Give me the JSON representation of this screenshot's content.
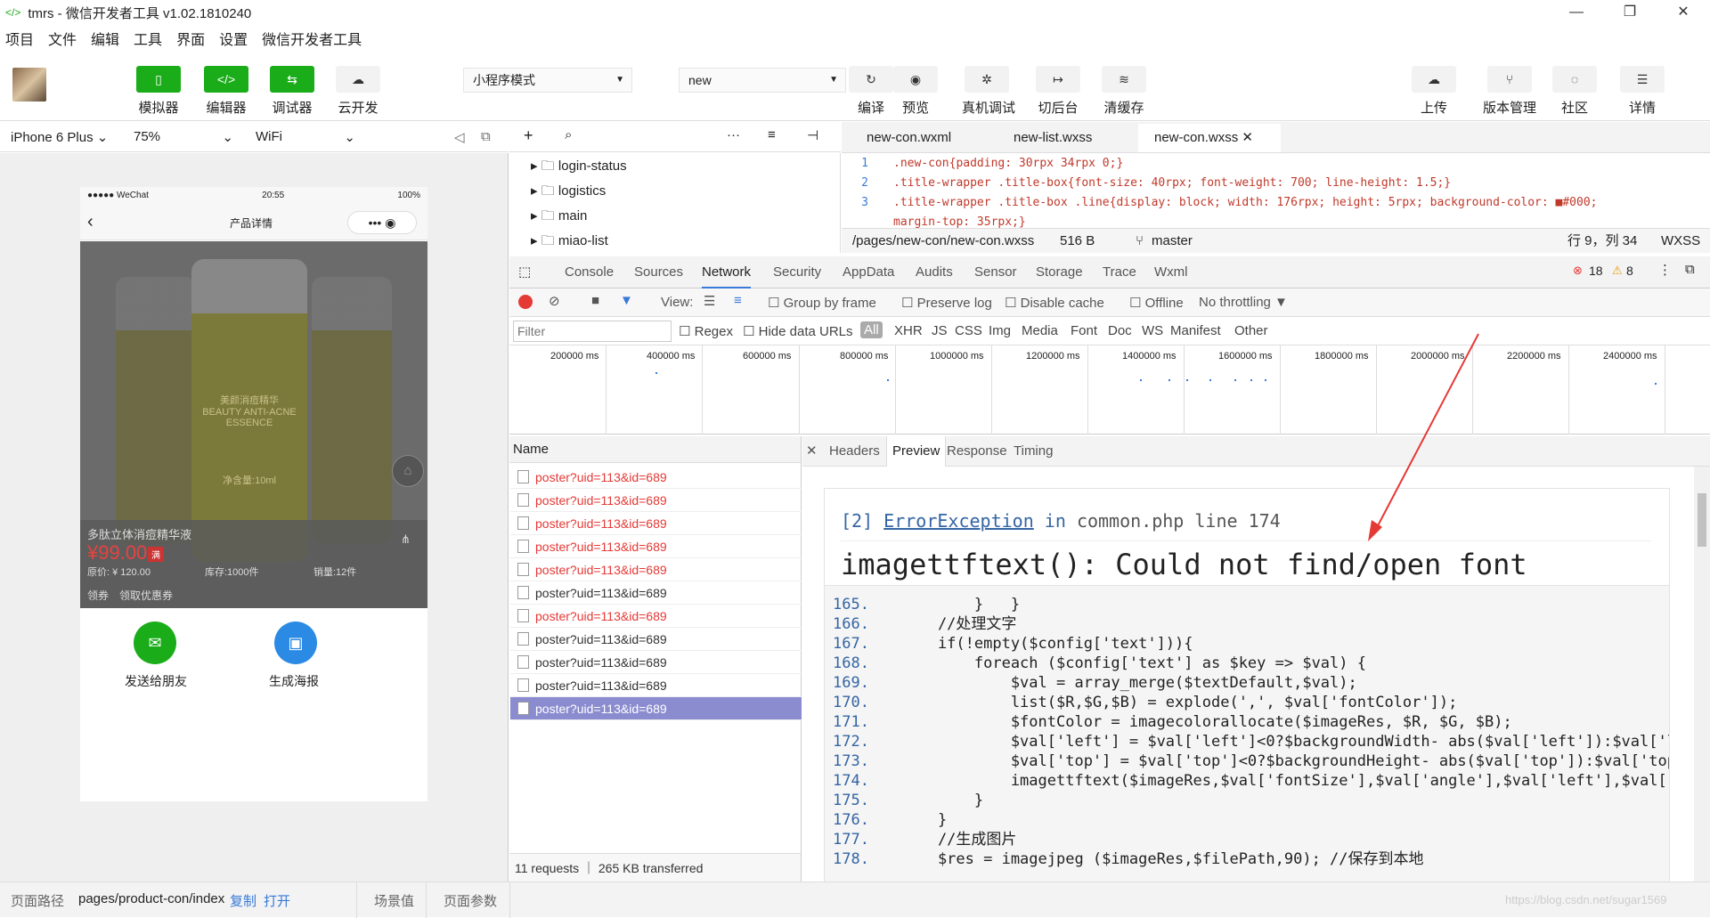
{
  "window": {
    "title": "tmrs - 微信开发者工具 v1.02.1810240",
    "min": "—",
    "max": "❐",
    "close": "✕"
  },
  "menu": [
    "项目",
    "文件",
    "编辑",
    "工具",
    "界面",
    "设置",
    "微信开发者工具"
  ],
  "toolbar": {
    "simulator": "模拟器",
    "editor": "编辑器",
    "debugger": "调试器",
    "cloud": "云开发",
    "mode": "小程序模式",
    "compile_select": "new",
    "compile": "编译",
    "preview": "预览",
    "remote_debug": "真机调试",
    "background": "切后台",
    "clear_cache": "清缓存",
    "upload": "上传",
    "version": "版本管理",
    "community": "社区",
    "details": "详情"
  },
  "simbar": {
    "device": "iPhone 6 Plus",
    "zoom": "75%",
    "network": "WiFi"
  },
  "phone": {
    "carrier": "●●●●● WeChat",
    "time": "20:55",
    "battery": "100%",
    "nav_title": "产品详情",
    "product_name": "多肽立体消痘精华液",
    "price": "¥99.00",
    "price_tag": "满",
    "orig_price": "原价: ¥ 120.00",
    "stock": "库存:1000件",
    "sales": "销量:12件",
    "coupon_label": "领券",
    "coupon_action": "领取优惠券",
    "bottle_text1": "美颜消痘精华",
    "bottle_text2": "BEAUTY ANTI-ACNE",
    "bottle_text3": "ESSENCE",
    "bottle_text4": "净含量:10ml",
    "share_friend": "发送给朋友",
    "gen_poster": "生成海报"
  },
  "filetree": [
    "login-status",
    "logistics",
    "main",
    "miao-list"
  ],
  "editor_tabs": [
    "new-con.wxml",
    "new-list.wxss",
    "new-con.wxss"
  ],
  "code_lines": [
    {
      "n": "1",
      "text": ".new-con{padding: 30rpx 34rpx 0;}"
    },
    {
      "n": "2",
      "text": ".title-wrapper .title-box{font-size: 40rpx; font-weight: 700; line-height: 1.5;}"
    },
    {
      "n": "3",
      "text": ".title-wrapper .title-box .line{display: block; width: 176rpx; height: 5rpx; background-color: ■#000;"
    },
    {
      "n": "",
      "text": "margin-top: 35rpx;}"
    }
  ],
  "editor_status": {
    "path": "/pages/new-con/new-con.wxss",
    "size": "516 B",
    "branch": "master",
    "pos": "行 9，列 34",
    "lang": "WXSS"
  },
  "devtools": {
    "tabs": [
      "Console",
      "Sources",
      "Network",
      "Security",
      "AppData",
      "Audits",
      "Sensor",
      "Storage",
      "Trace",
      "Wxml"
    ],
    "errors": "18",
    "warnings": "8",
    "view": "View:",
    "group_by_frame": "Group by frame",
    "preserve_log": "Preserve log",
    "disable_cache": "Disable cache",
    "offline": "Offline",
    "throttling": "No throttling",
    "filter_placeholder": "Filter",
    "regex": "Regex",
    "hide_data": "Hide data URLs",
    "types": [
      "All",
      "XHR",
      "JS",
      "CSS",
      "Img",
      "Media",
      "Font",
      "Doc",
      "WS",
      "Manifest",
      "Other"
    ],
    "timeline": [
      "200000 ms",
      "400000 ms",
      "600000 ms",
      "800000 ms",
      "1000000 ms",
      "1200000 ms",
      "1400000 ms",
      "1600000 ms",
      "1800000 ms",
      "2000000 ms",
      "2200000 ms",
      "2400000 ms"
    ],
    "name_header": "Name",
    "requests": [
      "poster?uid=113&id=689",
      "poster?uid=113&id=689",
      "poster?uid=113&id=689",
      "poster?uid=113&id=689",
      "poster?uid=113&id=689",
      "poster?uid=113&id=689",
      "poster?uid=113&id=689",
      "poster?uid=113&id=689",
      "poster?uid=113&id=689",
      "poster?uid=113&id=689",
      "poster?uid=113&id=689"
    ],
    "summary": "11 requests ｜ 265 KB transferred",
    "detail_tabs": [
      "Headers",
      "Preview",
      "Response",
      "Timing"
    ]
  },
  "preview": {
    "err_num": "[2]",
    "err_class": "ErrorException",
    "err_in": "in",
    "err_file": "common.php line 174",
    "err_msg": "imagettftext(): Could not find/open font",
    "lines": [
      {
        "n": "165.",
        "t": "        }   }"
      },
      {
        "n": "166.",
        "t": "    //处理文字"
      },
      {
        "n": "167.",
        "t": "    if(!empty($config['text'])){"
      },
      {
        "n": "168.",
        "t": "        foreach ($config['text'] as $key => $val) {"
      },
      {
        "n": "169.",
        "t": "            $val = array_merge($textDefault,$val);"
      },
      {
        "n": "170.",
        "t": "            list($R,$G,$B) = explode(',', $val['fontColor']);"
      },
      {
        "n": "171.",
        "t": "            $fontColor = imagecolorallocate($imageRes, $R, $G, $B);"
      },
      {
        "n": "172.",
        "t": "            $val['left'] = $val['left']<0?$backgroundWidth- abs($val['left']):$val['left']"
      },
      {
        "n": "173.",
        "t": "            $val['top'] = $val['top']<0?$backgroundHeight- abs($val['top']):$val['top'];"
      },
      {
        "n": "174.",
        "t": "            imagettftext($imageRes,$val['fontSize'],$val['angle'],$val['left'],$val['top']"
      },
      {
        "n": "175.",
        "t": "        }"
      },
      {
        "n": "176.",
        "t": "    }"
      },
      {
        "n": "177.",
        "t": "    //生成图片"
      },
      {
        "n": "178.",
        "t": "    $res = imagejpeg ($imageRes,$filePath,90); //保存到本地"
      }
    ]
  },
  "footer": {
    "path_label": "页面路径",
    "path": "pages/product-con/index",
    "copy": "复制",
    "open": "打开",
    "scene": "场景值",
    "params": "页面参数"
  },
  "watermark": "https://blog.csdn.net/sugar1569"
}
